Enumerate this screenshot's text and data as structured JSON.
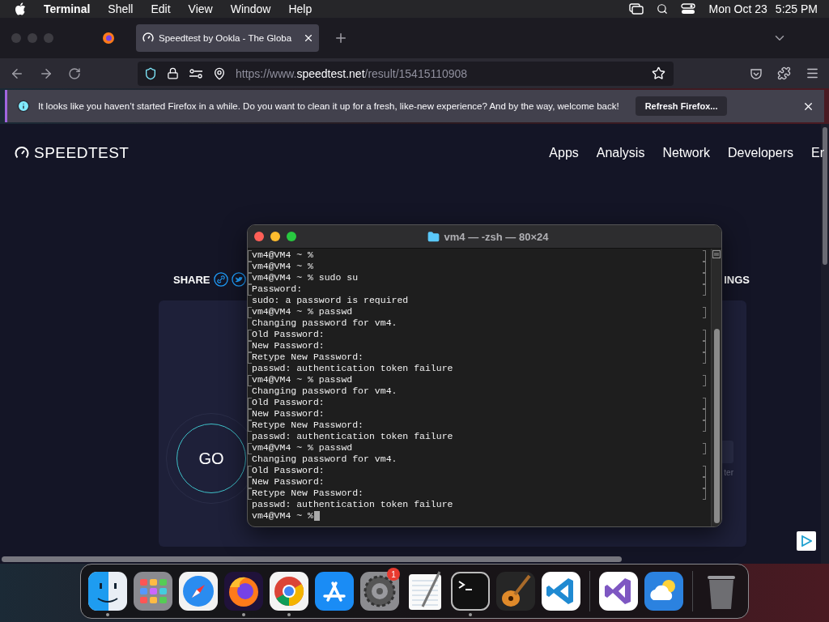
{
  "menu_bar": {
    "app": "Terminal",
    "menus": [
      "Shell",
      "Edit",
      "View",
      "Window",
      "Help"
    ],
    "date": "Mon Oct 23",
    "time": "5:25 PM"
  },
  "browser": {
    "tab": {
      "title": "Speedtest by Ookla - The Globa"
    },
    "url": {
      "prefix": "https://www.",
      "domain": "speedtest.net",
      "path": "/result/15415110908"
    },
    "notification": {
      "message": "It looks like you haven’t started Firefox in a while. Do you want to clean it up for a fresh, like-new experience? And by the way, welcome back!",
      "button": "Refresh Firefox..."
    }
  },
  "page": {
    "logo": "SPEEDTEST",
    "nav": [
      "Apps",
      "Analysis",
      "Network",
      "Developers",
      "Er"
    ],
    "share_label": "SHARE",
    "settings_fragment": "INGS",
    "go": "GO",
    "fragment": "ter"
  },
  "terminal": {
    "title": "vm4 — -zsh — 80×24",
    "lines": [
      {
        "text": "vm4@VM4 ~ %",
        "marked": true
      },
      {
        "text": "vm4@VM4 ~ %",
        "marked": true
      },
      {
        "text": "vm4@VM4 ~ % sudo su",
        "marked": true
      },
      {
        "text": "Password:",
        "marked": true
      },
      {
        "text": "sudo: a password is required",
        "marked": false
      },
      {
        "text": "vm4@VM4 ~ % passwd",
        "marked": true
      },
      {
        "text": "Changing password for vm4.",
        "marked": false
      },
      {
        "text": "Old Password:",
        "marked": true
      },
      {
        "text": "New Password:",
        "marked": true
      },
      {
        "text": "Retype New Password:",
        "marked": true
      },
      {
        "text": "passwd: authentication token failure",
        "marked": false
      },
      {
        "text": "vm4@VM4 ~ % passwd",
        "marked": true
      },
      {
        "text": "Changing password for vm4.",
        "marked": false
      },
      {
        "text": "Old Password:",
        "marked": true
      },
      {
        "text": "New Password:",
        "marked": true
      },
      {
        "text": "Retype New Password:",
        "marked": true
      },
      {
        "text": "passwd: authentication token failure",
        "marked": false
      },
      {
        "text": "vm4@VM4 ~ % passwd",
        "marked": true
      },
      {
        "text": "Changing password for vm4.",
        "marked": false
      },
      {
        "text": "Old Password:",
        "marked": true
      },
      {
        "text": "New Password:",
        "marked": true
      },
      {
        "text": "Retype New Password:",
        "marked": true
      },
      {
        "text": "passwd: authentication token failure",
        "marked": false
      },
      {
        "text": "vm4@VM4 ~ %",
        "marked": false
      }
    ],
    "cursor": true
  },
  "dock": {
    "items": [
      {
        "kind": "finder",
        "running": true
      },
      {
        "kind": "launchpad",
        "running": false
      },
      {
        "kind": "safari",
        "running": false
      },
      {
        "kind": "firefox",
        "running": true
      },
      {
        "kind": "chrome",
        "running": true
      },
      {
        "kind": "appstore",
        "running": false
      },
      {
        "kind": "settings",
        "running": false,
        "badge": "1"
      },
      {
        "kind": "textedit",
        "running": false
      },
      {
        "kind": "terminal",
        "running": true
      },
      {
        "kind": "garageband",
        "running": false
      },
      {
        "kind": "vscode",
        "running": false
      },
      {
        "kind": "separator"
      },
      {
        "kind": "visualstudio",
        "running": false
      },
      {
        "kind": "weather",
        "running": false
      },
      {
        "kind": "separator"
      },
      {
        "kind": "trash",
        "running": false
      }
    ]
  }
}
